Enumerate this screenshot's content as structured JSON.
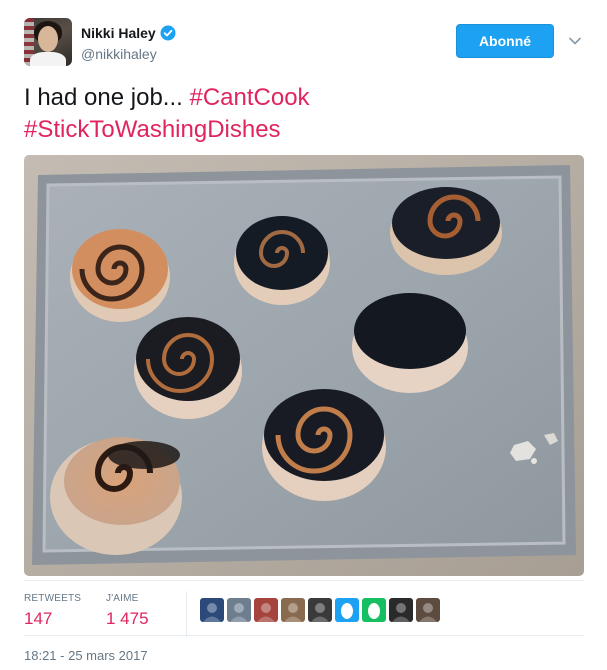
{
  "header": {
    "display_name": "Nikki Haley",
    "handle": "@nikkihaley",
    "follow_label": "Abonné"
  },
  "tweet": {
    "text_plain": "I had one job... ",
    "hashtag1": "#CantCook",
    "hashtag2": "#StickToWashingDishes"
  },
  "stats": {
    "retweets_label": "RETWEETS",
    "retweets_value": "147",
    "likes_label": "J'AIME",
    "likes_value": "1 475"
  },
  "likers": [
    {
      "icon": "avatar-1",
      "color": "#2b4a7a"
    },
    {
      "icon": "avatar-2",
      "color": "#6d7e8f"
    },
    {
      "icon": "avatar-3",
      "color": "#a5443c"
    },
    {
      "icon": "avatar-4",
      "color": "#8a6a4e"
    },
    {
      "icon": "avatar-5",
      "color": "#3a3a3a"
    },
    {
      "icon": "egg-avatar",
      "color": "#1da1f2"
    },
    {
      "icon": "egg-avatar",
      "color": "#17bf63"
    },
    {
      "icon": "avatar-8",
      "color": "#2a2a2a"
    },
    {
      "icon": "avatar-9",
      "color": "#5c4b3e"
    }
  ],
  "timestamp": "18:21 - 25 mars 2017",
  "colors": {
    "accent": "#1da1f2",
    "hashtag": "#e0245e",
    "muted": "#657786"
  }
}
